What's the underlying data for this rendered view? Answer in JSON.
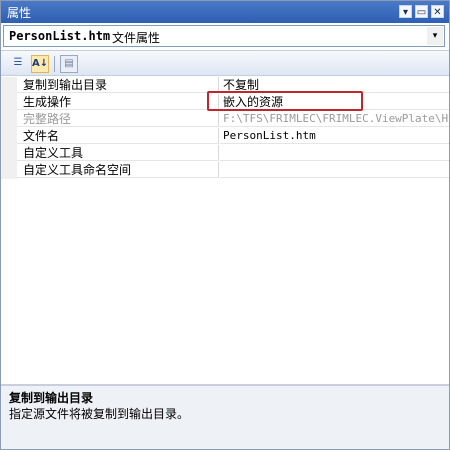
{
  "window": {
    "title": "属性",
    "buttons": {
      "dropdown": "▾",
      "pin": "▭",
      "close": "✕"
    }
  },
  "object_selector": {
    "name": "PersonList.htm",
    "type": "文件属性",
    "dropdown_icon": "▾"
  },
  "toolbar": {
    "categorized_icon": "☰",
    "alphabetical_label": "A↓",
    "property_pages_icon": "▤"
  },
  "properties": [
    {
      "name": "复制到输出目录",
      "value": "不复制",
      "disabled": false
    },
    {
      "name": "生成操作",
      "value": "嵌入的资源",
      "disabled": false
    },
    {
      "name": "完整路径",
      "value": "F:\\TFS\\FRIMLEC\\FRIMLEC.ViewPlate\\Html\\",
      "disabled": true
    },
    {
      "name": "文件名",
      "value": "PersonList.htm",
      "disabled": false
    },
    {
      "name": "自定义工具",
      "value": "",
      "disabled": false
    },
    {
      "name": "自定义工具命名空间",
      "value": "",
      "disabled": false
    }
  ],
  "description": {
    "title": "复制到输出目录",
    "text": "指定源文件将被复制到输出目录。"
  },
  "colors": {
    "titlebar": "#2f5fb2",
    "highlight_box": "#c0272d",
    "disabled_text": "#9a9a9a"
  }
}
